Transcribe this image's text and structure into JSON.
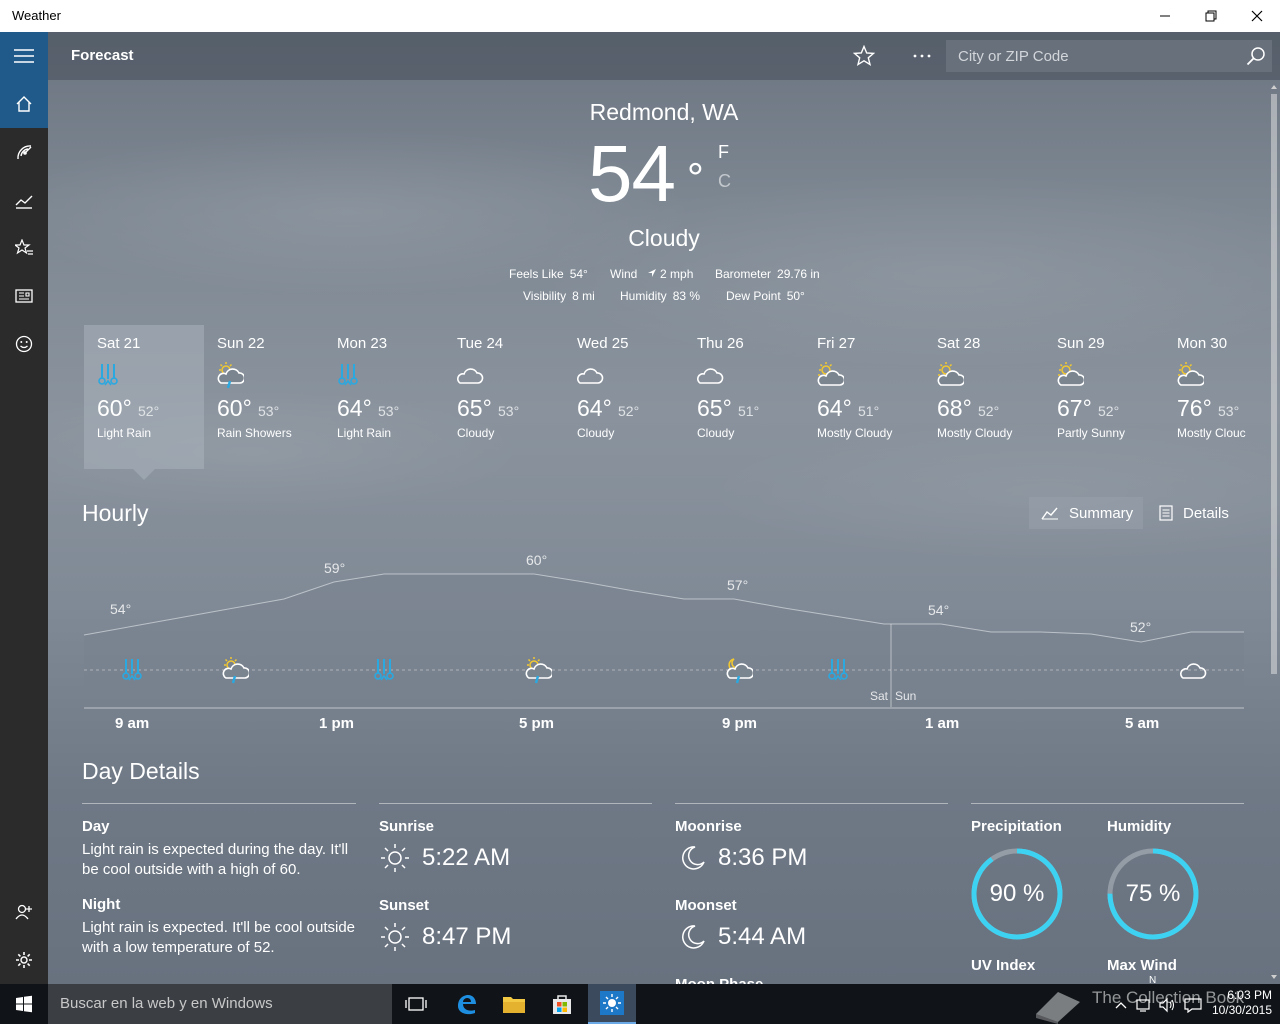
{
  "window": {
    "title": "Weather"
  },
  "header": {
    "title": "Forecast",
    "search_placeholder": "City or ZIP Code"
  },
  "current": {
    "location": "Redmond, WA",
    "temp": "54",
    "degree": "°",
    "unit_f": "F",
    "unit_c": "C",
    "condition": "Cloudy",
    "stats": [
      {
        "label": "Feels Like",
        "value": "54°"
      },
      {
        "label": "Wind",
        "value": "2 mph"
      },
      {
        "label": "Barometer",
        "value": "29.76 in"
      },
      {
        "label": "Visibility",
        "value": "8 mi"
      },
      {
        "label": "Humidity",
        "value": "83 %"
      },
      {
        "label": "Dew Point",
        "value": "50°"
      }
    ]
  },
  "daily": [
    {
      "day": "Sat 21",
      "hi": "60°",
      "lo": "52°",
      "desc": "Light Rain",
      "icon": "rain-icon"
    },
    {
      "day": "Sun 22",
      "hi": "60°",
      "lo": "53°",
      "desc": "Rain Showers",
      "icon": "sun-cloud-rain-icon"
    },
    {
      "day": "Mon 23",
      "hi": "64°",
      "lo": "53°",
      "desc": "Light Rain",
      "icon": "rain-icon"
    },
    {
      "day": "Tue 24",
      "hi": "65°",
      "lo": "53°",
      "desc": "Cloudy",
      "icon": "cloud-icon"
    },
    {
      "day": "Wed 25",
      "hi": "64°",
      "lo": "52°",
      "desc": "Cloudy",
      "icon": "cloud-icon"
    },
    {
      "day": "Thu 26",
      "hi": "65°",
      "lo": "51°",
      "desc": "Cloudy",
      "icon": "cloud-icon"
    },
    {
      "day": "Fri 27",
      "hi": "64°",
      "lo": "51°",
      "desc": "Mostly Cloudy",
      "icon": "sun-cloud-icon"
    },
    {
      "day": "Sat 28",
      "hi": "68°",
      "lo": "52°",
      "desc": "Mostly Cloudy",
      "icon": "sun-cloud-icon"
    },
    {
      "day": "Sun 29",
      "hi": "67°",
      "lo": "52°",
      "desc": "Partly Sunny",
      "icon": "sun-cloud-icon"
    },
    {
      "day": "Mon 30",
      "hi": "76°",
      "lo": "53°",
      "desc": "Mostly Clouc",
      "icon": "sun-cloud-icon"
    }
  ],
  "hourly": {
    "title": "Hourly",
    "summary_label": "Summary",
    "details_label": "Details",
    "temp_labels": [
      "54°",
      "59°",
      "60°",
      "57°",
      "54°",
      "52°"
    ],
    "time_labels": [
      "9 am",
      "1 pm",
      "5 pm",
      "9 pm",
      "1 am",
      "5 am"
    ],
    "day_split": [
      "Sat",
      "Sun"
    ],
    "icons": [
      "rain-icon",
      "sun-cloud-rain-icon",
      "rain-icon",
      "sun-cloud-rain-icon",
      "moon-cloud-rain-icon",
      "rain-icon",
      "cloud-icon"
    ]
  },
  "details": {
    "title": "Day Details",
    "day_label": "Day",
    "day_text_1": "Light rain is expected during the day. It'll",
    "day_text_2": "be cool outside with a high of 60.",
    "night_label": "Night",
    "night_text_1": "Light rain is expected. It'll be cool outside",
    "night_text_2": "with a low temperature of 52.",
    "sunrise_label": "Sunrise",
    "sunrise": "5:22 AM",
    "sunset_label": "Sunset",
    "sunset": "8:47 PM",
    "moonrise_label": "Moonrise",
    "moonrise": "8:36 PM",
    "moonset_label": "Moonset",
    "moonset": "5:44 AM",
    "moonphase_label": "Moon Phase",
    "precip_label": "Precipitation",
    "precip": "90 %",
    "precip_fraction": 0.9,
    "humidity_label": "Humidity",
    "humidity": "75 %",
    "humidity_fraction": 0.75,
    "uv_label": "UV Index",
    "wind_label": "Max Wind",
    "wind_dir": "N"
  },
  "taskbar": {
    "search": "Buscar en la web y en Windows",
    "time": "6:03 PM",
    "date": "10/30/2015",
    "watermark": "The Collection Book"
  },
  "colors": {
    "accent": "#1f5a8a",
    "rain_icon": "#2aa8e0",
    "sun_icon": "#f2c830",
    "ring": "#3ed2f2"
  }
}
